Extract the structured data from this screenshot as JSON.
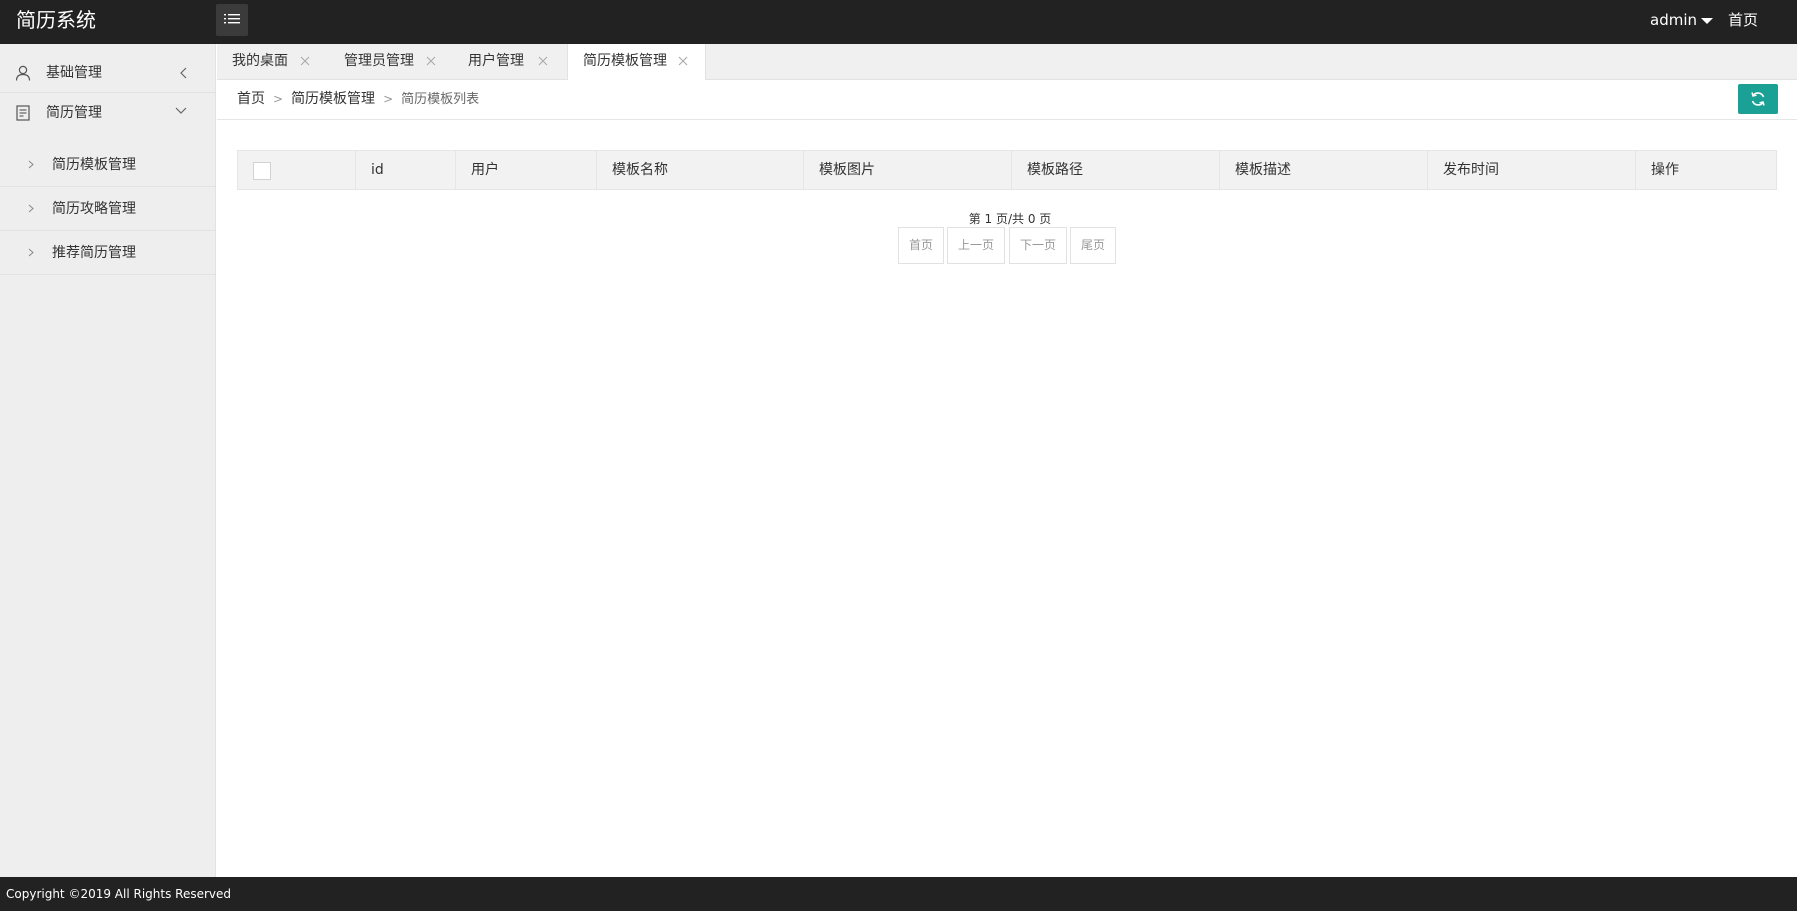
{
  "header": {
    "app_title": "简历系统",
    "user_label": "admin",
    "home_label": "首页"
  },
  "sidebar": {
    "groups": [
      {
        "label": "基础管理",
        "icon": "user-icon",
        "expanded": false
      },
      {
        "label": "简历管理",
        "icon": "document-icon",
        "expanded": true
      }
    ],
    "sub_items": [
      {
        "label": "简历模板管理"
      },
      {
        "label": "简历攻略管理"
      },
      {
        "label": "推荐简历管理"
      }
    ]
  },
  "tabs": [
    {
      "label": "我的桌面",
      "active": false
    },
    {
      "label": "管理员管理",
      "active": false
    },
    {
      "label": "用户管理",
      "active": false
    },
    {
      "label": "简历模板管理",
      "active": true
    }
  ],
  "breadcrumb": {
    "items": [
      "首页",
      "简历模板管理"
    ],
    "separator": ">",
    "current": "简历模板列表"
  },
  "table": {
    "columns": [
      "id",
      "用户",
      "模板名称",
      "模板图片",
      "模板路径",
      "模板描述",
      "发布时间",
      "操作"
    ],
    "rows": []
  },
  "pagination": {
    "info": "第 1 页/共 0 页",
    "buttons": [
      "首页",
      "上一页",
      "下一页",
      "尾页"
    ]
  },
  "footer": {
    "copyright": "Copyright ©2019 All Rights Reserved"
  },
  "colors": {
    "header_bg": "#222222",
    "sidebar_bg": "#eeeeee",
    "accent": "#1aa094"
  }
}
